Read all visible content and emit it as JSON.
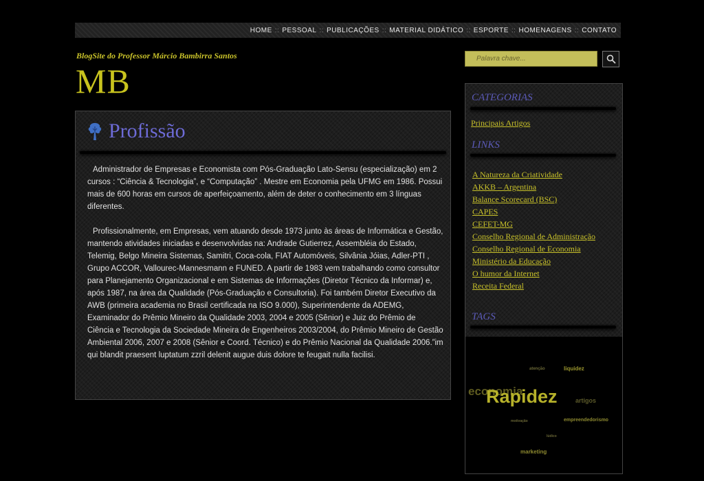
{
  "nav": {
    "items": [
      "HOME",
      "PESSOAL",
      "PUBLICAÇÕES",
      "MATERIAL DIDÁTICO",
      "ESPORTE",
      "HOMENAGENS",
      "CONTATO"
    ],
    "separator": "::"
  },
  "header": {
    "tagline": "BlogSite do Professor Márcio Bambirra Santos",
    "logo": "MB"
  },
  "search": {
    "placeholder": "Palavra chave..."
  },
  "post": {
    "title": "Profissão",
    "paragraph1": "Administrador de Empresas e Economista com Pós-Graduação Lato-Sensu (especialização) em 2 cursos : “Ciência & Tecnologia”, e “Computação” . Mestre em Economia pela UFMG em 1986. Possui mais de 600 horas em cursos de aperfeiçoamento, além de deter o conhecimento em 3 línguas diferentes.",
    "paragraph2": "Profissionalmente, em Empresas, vem atuando desde 1973 junto às áreas de Informática e Gestão, mantendo atividades iniciadas e desenvolvidas na: Andrade Gutierrez, Assembléia do Estado, Telemig, Belgo Mineira Sistemas, Samitri, Coca-cola, FIAT Automóveis, Silvânia Jóias, Adler-PTI , Grupo ACCOR, Vallourec-Mannesmann e FUNED. A partir de 1983 vem trabalhando como consultor para Planejamento Organizacional e em Sistemas de Informações (Diretor Técnico da Informar) e, após 1987, na área da Qualidade (Pós-Graduação e Consultoria). Foi também Diretor Executivo da AWB (primeira academia no Brasil certificada na ISO 9.000), Superintendente da ADEMG, Examinador do Prêmio Mineiro da Qualidade 2003, 2004 e 2005 (Sênior) e Juiz do Prêmio de Ciência e Tecnologia da Sociedade Mineira de Engenheiros 2003/2004, do Prêmio Mineiro de Gestão Ambiental 2006, 2007 e 2008 (Sênior e Coord. Técnico) e do Prêmio Nacional da Qualidade 2006.”im qui blandit praesent luptatum zzril delenit augue duis dolore te feugait nulla facilisi."
  },
  "sidebar": {
    "categories_heading": "CATEGORIAS",
    "categories": [
      "Principais Artigos"
    ],
    "links_heading": "LINKS",
    "links": [
      "A Natureza da Criatividade",
      "AKKB – Argentina",
      "Balance Scorecard (BSC)",
      "CAPES",
      "CEFET-MG",
      "Conselho Regional de Administração",
      "Conselho Regional de Economia",
      "Ministério da Educação",
      "O humor da Internet",
      "Receita Federal"
    ],
    "tags_heading": "TAGS",
    "tags": [
      "atenção",
      "liquidez",
      "economia",
      "Rapidez",
      "artigos",
      "motivação",
      "empreendedorismo",
      "lúdico",
      "marketing"
    ]
  },
  "colors": {
    "accent_yellow": "#c9c22a",
    "heading_blue": "#5b5ab8",
    "title_blue": "#6d6bd6"
  },
  "icons": [
    "search-icon",
    "tree-icon"
  ]
}
